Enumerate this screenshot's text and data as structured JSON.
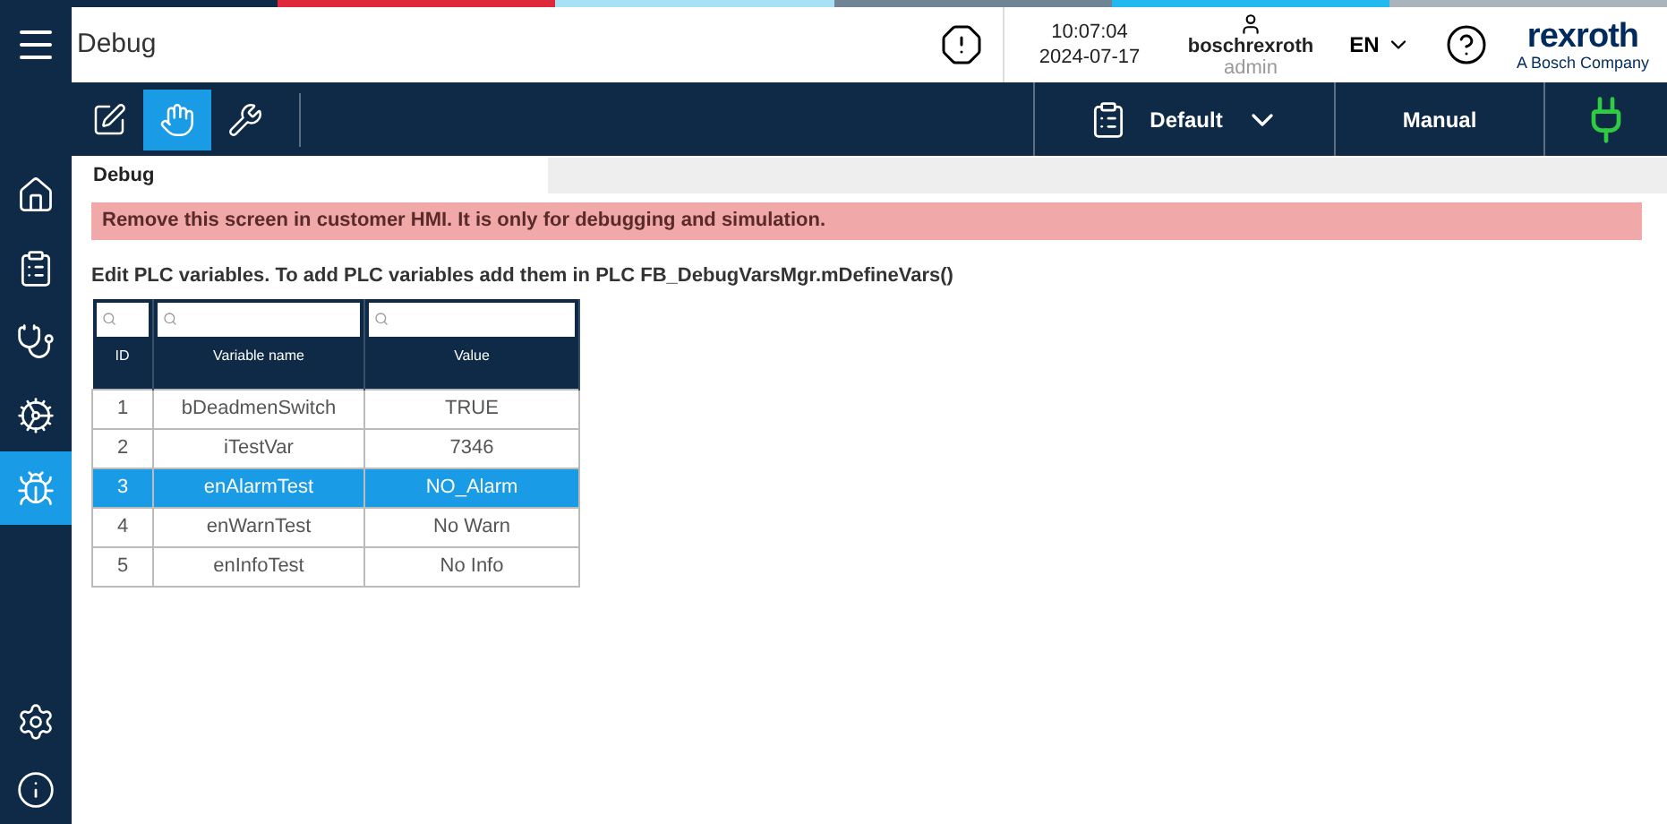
{
  "header": {
    "title": "Debug",
    "time": "10:07:04",
    "date": "2024-07-17",
    "user": "boschrexroth",
    "role": "admin",
    "language": "EN",
    "logo": "rexroth",
    "logo_subtitle": "A Bosch Company"
  },
  "status_strip": [
    {
      "color": "#0f2a47"
    },
    {
      "color": "#e0283c"
    },
    {
      "color": "#a8e0f4"
    },
    {
      "color": "#6f8494"
    },
    {
      "color": "#22b8f0"
    },
    {
      "color": "#a9b4bc"
    }
  ],
  "sidebar": {
    "items": [
      {
        "kind": "home",
        "selected": false
      },
      {
        "kind": "clipboard",
        "selected": false
      },
      {
        "kind": "stethoscope",
        "selected": false
      },
      {
        "kind": "gears",
        "selected": false
      },
      {
        "kind": "bug",
        "selected": true
      }
    ],
    "bottom": [
      {
        "kind": "settings"
      },
      {
        "kind": "info"
      }
    ]
  },
  "toolbar": {
    "buttons": [
      {
        "kind": "edit",
        "selected": false
      },
      {
        "kind": "hand",
        "selected": true
      },
      {
        "kind": "tools",
        "selected": false
      }
    ],
    "recipe": "Default",
    "mode": "Manual",
    "connected": true
  },
  "tabs": [
    {
      "label": "Debug",
      "selected": true
    }
  ],
  "warning": "Remove this screen in customer HMI. It is only for debugging and simulation.",
  "instructions": "Edit PLC variables. To add PLC variables add them in PLC FB_DebugVarsMgr.mDefineVars()",
  "table": {
    "columns": [
      "ID",
      "Variable name",
      "Value"
    ],
    "rows": [
      {
        "id": "1",
        "name": "bDeadmenSwitch",
        "value": "TRUE",
        "selected": false
      },
      {
        "id": "2",
        "name": "iTestVar",
        "value": "7346",
        "selected": false
      },
      {
        "id": "3",
        "name": "enAlarmTest",
        "value": "NO_Alarm",
        "selected": true
      },
      {
        "id": "4",
        "name": "enWarnTest",
        "value": "No Warn",
        "selected": false
      },
      {
        "id": "5",
        "name": "enInfoTest",
        "value": "No Info",
        "selected": false
      }
    ]
  }
}
